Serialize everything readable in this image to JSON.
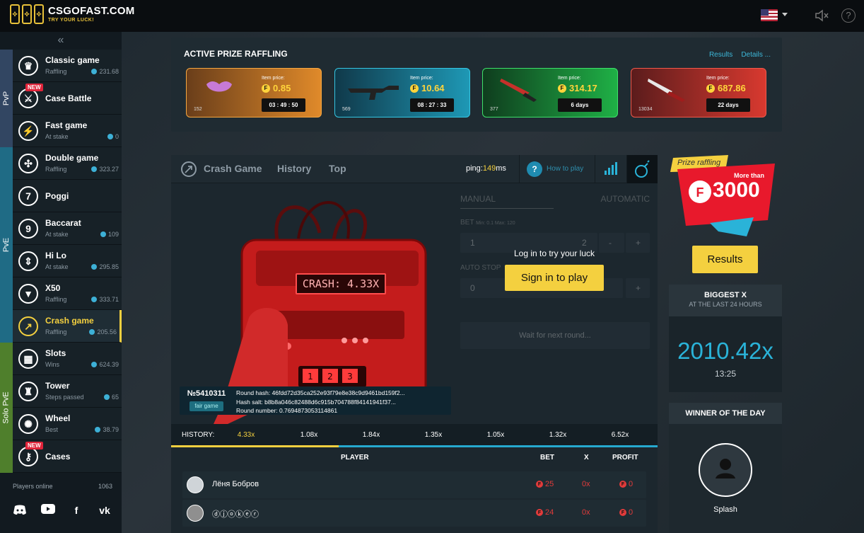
{
  "header": {
    "logo_title": "CSGOFAST.COM",
    "logo_sub": "TRY YOUR LUCK!",
    "flag_icon": "us-flag-icon",
    "mute_icon": "speaker-muted-icon",
    "help_icon": "?"
  },
  "sidebar": {
    "collapse": "«",
    "sections": {
      "pvp": "PvP",
      "pve": "PvE",
      "solo": "Solo PvE"
    },
    "items": [
      {
        "title": "Classic game",
        "sub": "Raffling",
        "value": "231.68",
        "icon": "crown-icon",
        "glyph": "♛"
      },
      {
        "title": "Case Battle",
        "sub": "",
        "value": "",
        "icon": "swords-icon",
        "glyph": "⚔",
        "badge": "NEW"
      },
      {
        "title": "Fast game",
        "sub": "At stake",
        "value": "0",
        "icon": "lightning-icon",
        "glyph": "⚡"
      },
      {
        "title": "Double game",
        "sub": "Raffling",
        "value": "323.27",
        "icon": "double-icon",
        "glyph": "✣"
      },
      {
        "title": "Poggi",
        "sub": "",
        "value": "",
        "icon": "seven-icon",
        "glyph": "7"
      },
      {
        "title": "Baccarat",
        "sub": "At stake",
        "value": "109",
        "icon": "nine-icon",
        "glyph": "9"
      },
      {
        "title": "Hi Lo",
        "sub": "At stake",
        "value": "295.85",
        "icon": "hilo-icon",
        "glyph": "⇕"
      },
      {
        "title": "X50",
        "sub": "Raffling",
        "value": "333.71",
        "icon": "x50-icon",
        "glyph": "▼"
      },
      {
        "title": "Crash game",
        "sub": "Raffling",
        "value": "205.56",
        "icon": "crash-arrow-icon",
        "glyph": "↗"
      },
      {
        "title": "Slots",
        "sub": "Wins",
        "value": "624.39",
        "icon": "slots-icon",
        "glyph": "▦"
      },
      {
        "title": "Tower",
        "sub": "Steps passed",
        "value": "65",
        "icon": "tower-icon",
        "glyph": "♜"
      },
      {
        "title": "Wheel",
        "sub": "Best",
        "value": "38.79",
        "icon": "wheel-icon",
        "glyph": "✺"
      },
      {
        "title": "Cases",
        "sub": "",
        "value": "",
        "icon": "key-icon",
        "glyph": "⚷",
        "badge": "NEW"
      }
    ],
    "players_online_label": "Players online",
    "players_online_value": "1063",
    "socials": [
      "discord-icon",
      "youtube-icon",
      "facebook-icon",
      "vk-icon"
    ]
  },
  "prize": {
    "title": "ACTIVE PRIZE RAFFLING",
    "links": [
      "Results",
      "Details ..."
    ],
    "cards": [
      {
        "label": "Item price:",
        "price": "0.85",
        "timer": "03 : 49 : 50",
        "count": "152",
        "color": "orange"
      },
      {
        "label": "Item price:",
        "price": "10.64",
        "timer": "08 : 27 : 33",
        "count": "569",
        "color": "blue"
      },
      {
        "label": "Item price:",
        "price": "314.17",
        "timer": "6 days",
        "count": "377",
        "color": "green"
      },
      {
        "label": "Item price:",
        "price": "687.86",
        "timer": "22 days",
        "count": "13034",
        "color": "red"
      }
    ]
  },
  "game": {
    "tabs": [
      "Crash Game",
      "History",
      "Top"
    ],
    "ping_label": "ping:",
    "ping_value": "149",
    "ping_unit": "ms",
    "how_to": "How to play",
    "crash_display": "CRASH: 4.33X",
    "bet": {
      "tab_manual": "MANUAL",
      "tab_auto": "AUTOMATIC",
      "bet_label": "BET",
      "bet_limits": "Min: 0.1 Max: 120",
      "bet_value": "1",
      "mult_value": "2",
      "autostop_label": "AUTO STOP",
      "autostop_value": "0",
      "wait_text": "Wait for next round...",
      "minus": "-",
      "plus": "+"
    },
    "login_text": "Log in to try your luck",
    "signin": "Sign in to play",
    "round_id": "№5410311",
    "fair": "fair game",
    "hash": "Round hash: 46fdd72d35ca252e93f79e8e38c9d9461bd159f2...",
    "salt": "Hash salt: b8b8a046c82488d6c915b704788f84141941f37...",
    "round_number": "Round number: 0.7694873053114861",
    "history_label": "HISTORY:",
    "history": [
      "4.33x",
      "1.08x",
      "1.84x",
      "1.35x",
      "1.05x",
      "1.32x",
      "6.52x"
    ],
    "table_headers": {
      "player": "PLAYER",
      "bet": "BET",
      "x": "X",
      "profit": "PROFIT"
    },
    "rows": [
      {
        "name": "Лёня Бобров",
        "bet": "25",
        "x": "0x",
        "profit": "0"
      },
      {
        "name": "ⓓⓙⓞⓚⓔⓡ",
        "bet": "24",
        "x": "0x",
        "profit": "0"
      }
    ]
  },
  "right": {
    "promo_ribbon": "Prize raffling",
    "promo_more": "More than",
    "promo_amount": "3000",
    "results": "Results",
    "biggest_title": "BIGGEST X",
    "biggest_sub": "AT THE LAST 24 HOURS",
    "biggest_value": "2010.42x",
    "biggest_time": "13:25",
    "winner_title": "WINNER OF THE DAY",
    "winner_name": "Splash"
  }
}
